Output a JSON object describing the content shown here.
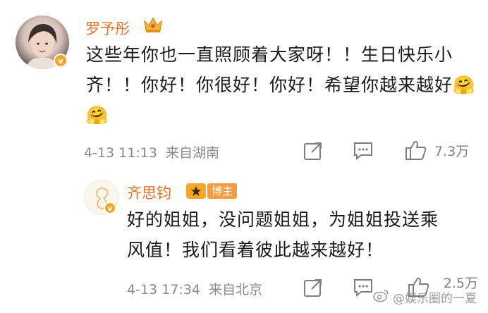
{
  "comment": {
    "username": "罗予彤",
    "text": "这些年你也一直照顾着大家呀！！生日快乐小齐！！你好！你很好！你好！希望你越来越好🤗🤗",
    "time": "4-13 11:13",
    "location": "来自湖南",
    "likes": "7.3万",
    "icons": [
      "share-icon",
      "comment-icon",
      "like-icon",
      "crown-icon",
      "verified-icon"
    ]
  },
  "reply": {
    "username": "齐思钧",
    "badge": "博主",
    "text": "好的姐姐，没问题姐姐，为姐姐投送乘风值！我们看着彼此越来越好！",
    "time": "4-13 17:34",
    "location": "来自北京",
    "likes": "2.5万"
  },
  "watermark": "@娱乐圈的一夏",
  "colors": {
    "username": "#e8732c",
    "verified": "#f5a623",
    "badge": "#f39b45",
    "meta": "#8a8a8a"
  }
}
